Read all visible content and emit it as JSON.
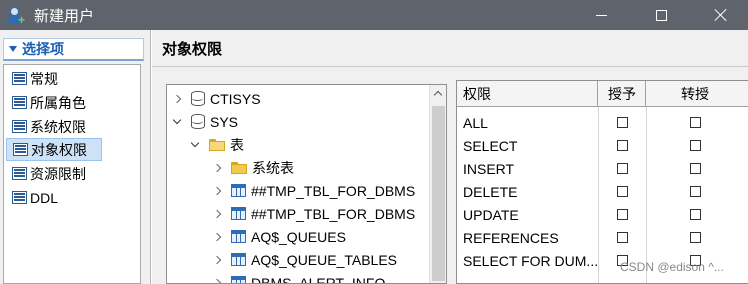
{
  "window": {
    "title": "新建用户"
  },
  "nav": {
    "header": "选择项",
    "items": [
      {
        "label": "常规"
      },
      {
        "label": "所属角色"
      },
      {
        "label": "系统权限"
      },
      {
        "label": "对象权限",
        "selected": true
      },
      {
        "label": "资源限制"
      },
      {
        "label": "DDL"
      }
    ]
  },
  "section": {
    "title": "对象权限"
  },
  "tree": {
    "nodes": [
      {
        "label": "CTISYS",
        "icon": "database-icon",
        "expanded": false,
        "level": 0
      },
      {
        "label": "SYS",
        "icon": "database-icon",
        "expanded": true,
        "level": 0
      },
      {
        "label": "表",
        "icon": "folder-open-icon",
        "expanded": true,
        "level": 1
      },
      {
        "label": "系统表",
        "icon": "folder-icon",
        "expanded": false,
        "level": 2
      },
      {
        "label": "##TMP_TBL_FOR_DBMS",
        "icon": "table-icon",
        "expanded": false,
        "level": 2
      },
      {
        "label": "##TMP_TBL_FOR_DBMS",
        "icon": "table-icon",
        "expanded": false,
        "level": 2
      },
      {
        "label": "AQ$_QUEUES",
        "icon": "table-icon",
        "expanded": false,
        "level": 2
      },
      {
        "label": "AQ$_QUEUE_TABLES",
        "icon": "table-icon",
        "expanded": false,
        "level": 2
      },
      {
        "label": "DBMS_ALERT_INFO",
        "icon": "table-icon",
        "expanded": false,
        "level": 2
      }
    ]
  },
  "privileges": {
    "columns": [
      "权限",
      "授予",
      "转授"
    ],
    "rows": [
      {
        "name": "ALL",
        "grant": false,
        "regrant": false
      },
      {
        "name": "SELECT",
        "grant": false,
        "regrant": false
      },
      {
        "name": "INSERT",
        "grant": false,
        "regrant": false
      },
      {
        "name": "DELETE",
        "grant": false,
        "regrant": false
      },
      {
        "name": "UPDATE",
        "grant": false,
        "regrant": false
      },
      {
        "name": "REFERENCES",
        "grant": false,
        "regrant": false
      },
      {
        "name": "SELECT FOR DUM...",
        "grant": false,
        "regrant": false
      }
    ]
  },
  "watermark": "CSDN @edison ^..."
}
